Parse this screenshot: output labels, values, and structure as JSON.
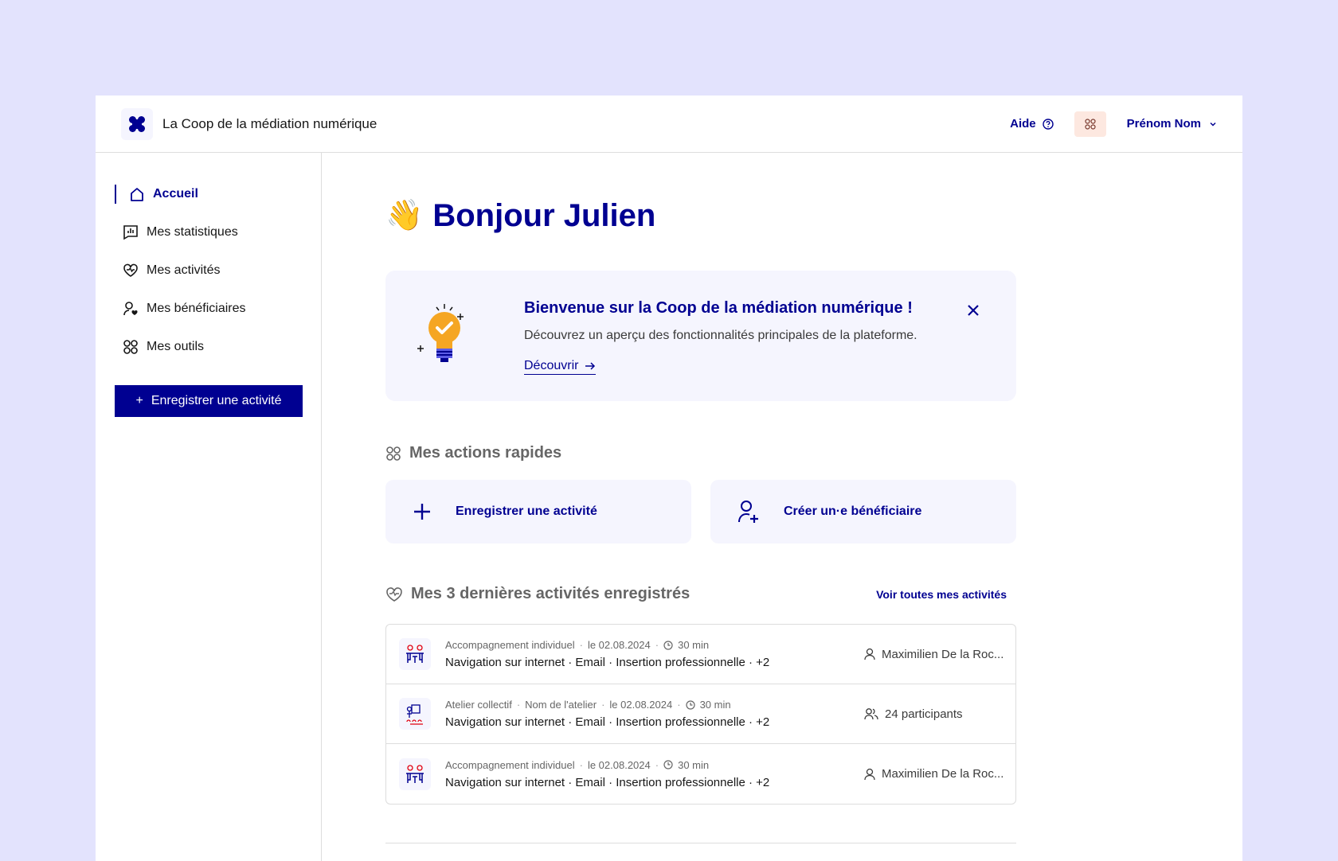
{
  "header": {
    "brand": "La Coop de la médiation numérique",
    "help": "Aide",
    "user": "Prénom Nom"
  },
  "sidebar": {
    "items": [
      {
        "label": "Accueil"
      },
      {
        "label": "Mes statistiques"
      },
      {
        "label": "Mes activités"
      },
      {
        "label": "Mes bénéficiaires"
      },
      {
        "label": "Mes outils"
      }
    ],
    "cta": "Enregistrer une activité"
  },
  "main": {
    "greeting": "Bonjour Julien",
    "welcome": {
      "title": "Bienvenue sur la Coop de la médiation numérique !",
      "text": "Découvrez un aperçu des fonctionnalités principales de la plateforme.",
      "link": "Découvrir"
    },
    "quick_actions": {
      "title": "Mes actions rapides",
      "items": [
        {
          "label": "Enregistrer une activité"
        },
        {
          "label": "Créer un·e bénéficiaire"
        }
      ]
    },
    "recent": {
      "title": "Mes 3 dernières activités enregistrés",
      "see_all": "Voir toutes mes activités",
      "rows": [
        {
          "type": "Accompagnement individuel",
          "workshop": "",
          "date": "le 02.08.2024",
          "duration": "30 min",
          "tags": "Navigation sur internet · Email · Insertion professionnelle · +2",
          "who": "Maximilien De la Roc..."
        },
        {
          "type": "Atelier collectif",
          "workshop": "Nom de l'atelier",
          "date": "le 02.08.2024",
          "duration": "30 min",
          "tags": "Navigation sur internet · Email · Insertion professionnelle · +2",
          "who": "24 participants"
        },
        {
          "type": "Accompagnement individuel",
          "workshop": "",
          "date": "le 02.08.2024",
          "duration": "30 min",
          "tags": "Navigation sur internet · Email · Insertion professionnelle · +2",
          "who": "Maximilien De la Roc..."
        }
      ]
    }
  }
}
